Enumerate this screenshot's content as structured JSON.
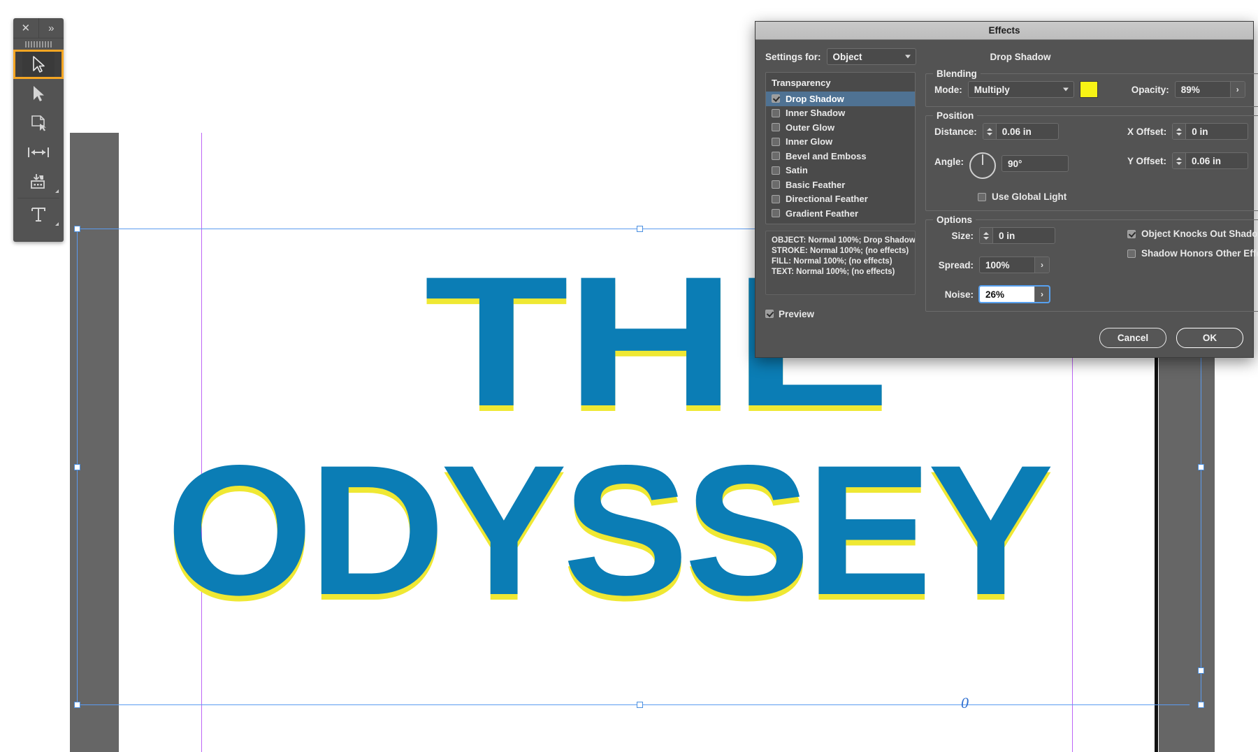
{
  "app": {
    "canvas_bg": "#ffffff",
    "pasteboard_color": "#666666"
  },
  "toolbar": {
    "close_glyph": "✕",
    "expand_glyph": "»",
    "tools": [
      {
        "name": "selection-tool",
        "label": "Selection Tool",
        "selected": true
      },
      {
        "name": "direct-selection-tool",
        "label": "Direct Selection Tool",
        "selected": false
      },
      {
        "name": "page-tool",
        "label": "Page Tool",
        "selected": false
      },
      {
        "name": "gap-tool",
        "label": "Gap Tool",
        "selected": false
      },
      {
        "name": "content-collector-tool",
        "label": "Content Collector Tool",
        "selected": false
      },
      {
        "name": "type-tool",
        "label": "Type Tool",
        "selected": false
      }
    ]
  },
  "artwork": {
    "line1": "THE",
    "line2": "ODYSSEY",
    "fill_color": "#0b7db5",
    "shadow_color": "#efe833",
    "anchor_marker": "0"
  },
  "dialog": {
    "title": "Effects",
    "settings_for_label": "Settings for:",
    "settings_for_value": "Object",
    "panel_heading": "Drop Shadow",
    "effects_list": {
      "header": "Transparency",
      "items": [
        {
          "label": "Drop Shadow",
          "checked": true,
          "active": true
        },
        {
          "label": "Inner Shadow",
          "checked": false,
          "active": false
        },
        {
          "label": "Outer Glow",
          "checked": false,
          "active": false
        },
        {
          "label": "Inner Glow",
          "checked": false,
          "active": false
        },
        {
          "label": "Bevel and Emboss",
          "checked": false,
          "active": false
        },
        {
          "label": "Satin",
          "checked": false,
          "active": false
        },
        {
          "label": "Basic Feather",
          "checked": false,
          "active": false
        },
        {
          "label": "Directional Feather",
          "checked": false,
          "active": false
        },
        {
          "label": "Gradient Feather",
          "checked": false,
          "active": false
        }
      ]
    },
    "status": {
      "line1": "OBJECT: Normal 100%; Drop Shadow",
      "line2": "STROKE: Normal 100%; (no effects)",
      "line3": "FILL: Normal 100%; (no effects)",
      "line4": "TEXT: Normal 100%; (no effects)"
    },
    "preview": {
      "label": "Preview",
      "checked": true
    },
    "blending": {
      "legend": "Blending",
      "mode_label": "Mode:",
      "mode_value": "Multiply",
      "swatch_color": "#f7f315",
      "opacity_label": "Opacity:",
      "opacity_value": "89%",
      "opacity_arrow": "›"
    },
    "position": {
      "legend": "Position",
      "distance_label": "Distance:",
      "distance_value": "0.06 in",
      "angle_label": "Angle:",
      "angle_value": "90°",
      "x_offset_label": "X Offset:",
      "x_offset_value": "0 in",
      "y_offset_label": "Y Offset:",
      "y_offset_value": "0.06 in",
      "use_global_light_label": "Use Global Light",
      "use_global_light_checked": false
    },
    "options": {
      "legend": "Options",
      "size_label": "Size:",
      "size_value": "0 in",
      "spread_label": "Spread:",
      "spread_value": "100%",
      "spread_arrow": "›",
      "noise_label": "Noise:",
      "noise_value": "26%",
      "noise_arrow": "›",
      "noise_focused": true,
      "knockout_label": "Object Knocks Out Shadow",
      "knockout_checked": true,
      "honors_label": "Shadow Honors Other Effects",
      "honors_checked": false
    },
    "buttons": {
      "cancel": "Cancel",
      "ok": "OK"
    }
  }
}
